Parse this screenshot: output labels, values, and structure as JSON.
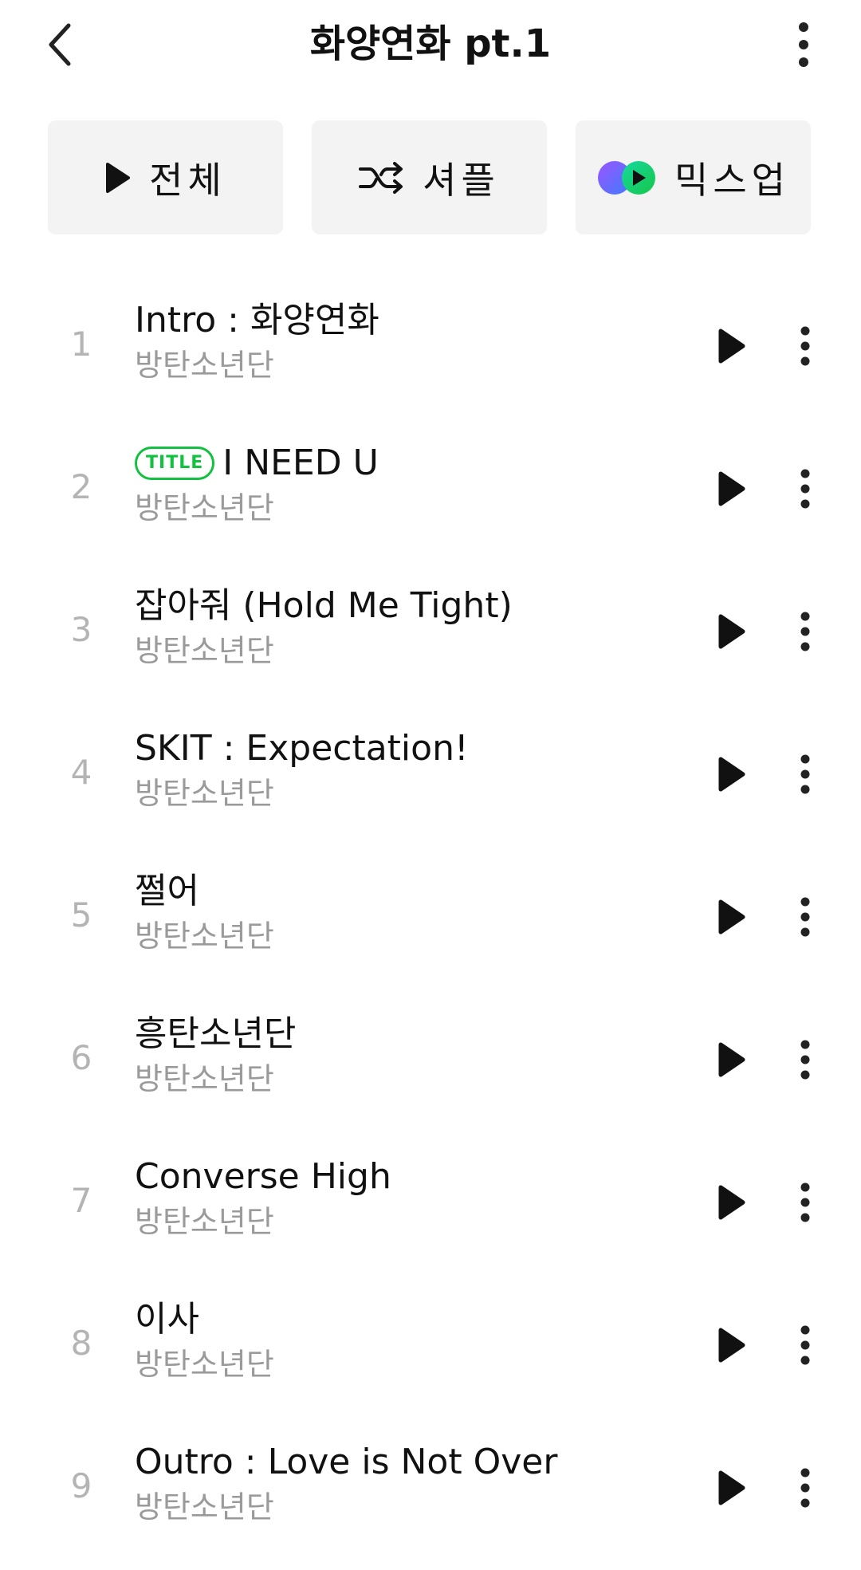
{
  "header": {
    "title": "화양연화 pt.1",
    "back_icon": "chevron-left-icon",
    "more_icon": "vertical-dots-icon"
  },
  "actions": {
    "play_all_label": "전체",
    "shuffle_label": "셔플",
    "mixup_label": "믹스업"
  },
  "colors": {
    "accent_green": "#11c13f",
    "button_bg": "#f3f3f3",
    "track_number": "#b4b4b4",
    "artist_text": "#9a9a9a"
  },
  "tracks": [
    {
      "number": "1",
      "title": "Intro : 화양연화",
      "artist": "방탄소년단",
      "badge": ""
    },
    {
      "number": "2",
      "title": "I NEED U",
      "artist": "방탄소년단",
      "badge": "TITLE"
    },
    {
      "number": "3",
      "title": "잡아줘 (Hold Me Tight)",
      "artist": "방탄소년단",
      "badge": ""
    },
    {
      "number": "4",
      "title": "SKIT : Expectation!",
      "artist": "방탄소년단",
      "badge": ""
    },
    {
      "number": "5",
      "title": "쩔어",
      "artist": "방탄소년단",
      "badge": ""
    },
    {
      "number": "6",
      "title": "흥탄소년단",
      "artist": "방탄소년단",
      "badge": ""
    },
    {
      "number": "7",
      "title": "Converse High",
      "artist": "방탄소년단",
      "badge": ""
    },
    {
      "number": "8",
      "title": "이사",
      "artist": "방탄소년단",
      "badge": ""
    },
    {
      "number": "9",
      "title": "Outro : Love is Not Over",
      "artist": "방탄소년단",
      "badge": ""
    }
  ]
}
